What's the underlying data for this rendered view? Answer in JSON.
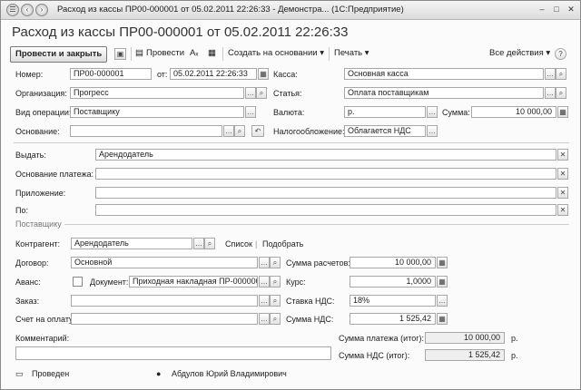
{
  "window": {
    "title": "Расход из кассы ПР00-000001 от 05.02.2011 22:26:33 - Демонстра... (1С:Предприятие)",
    "min_label": "–",
    "max_label": "□",
    "close_label": "✕"
  },
  "form": {
    "title": "Расход из кассы ПР00-000001 от 05.02.2011 22:26:33"
  },
  "toolbar": {
    "post_close": "Провести и закрыть",
    "post": "Провести",
    "create_based": "Создать на основании ▾",
    "print": "Печать ▾",
    "all_actions": "Все действия ▾",
    "help": "?"
  },
  "fields": {
    "number_label": "Номер:",
    "number": "ПР00-000001",
    "from_label": "от:",
    "date": "05.02.2011 22:26:33",
    "cashbox_label": "Касса:",
    "cashbox": "Основная касса",
    "org_label": "Организация:",
    "org": "Прогресс",
    "article_label": "Статья:",
    "article": "Оплата поставщикам",
    "optype_label": "Вид операции:",
    "optype": "Поставщику",
    "currency_label": "Валюта:",
    "currency": "р.",
    "sum_label": "Сумма:",
    "sum": "10 000,00",
    "basis_label": "Основание:",
    "basis": "",
    "tax_label": "Налогообложение:",
    "tax": "Облагается НДС",
    "issue_label": "Выдать:",
    "issue": "Арендодатель",
    "paybasis_label": "Основание платежа:",
    "paybasis": "",
    "attach_label": "Приложение:",
    "attach": "",
    "by_label": "По:",
    "by": ""
  },
  "supplier": {
    "group_label": "Поставщику",
    "counterparty_label": "Контрагент:",
    "counterparty": "Арендодатель",
    "list_link": "Список",
    "select_link": "Подобрать",
    "contract_label": "Договор:",
    "contract": "Основной",
    "calc_sum_label": "Сумма расчетов:",
    "calc_sum": "10 000,00",
    "advance_label": "Аванс:",
    "document_label": "Документ:",
    "document": "Приходная накладная ПР-000000",
    "rate_label": "Курс:",
    "rate": "1,0000",
    "order_label": "Заказ:",
    "order": "",
    "vat_rate_label": "Ставка НДС:",
    "vat_rate": "18%",
    "invoice_label": "Счет на оплату:",
    "invoice": "",
    "vat_sum_label": "Сумма НДС:",
    "vat_sum": "1 525,42"
  },
  "footer": {
    "comment_label": "Комментарий:",
    "comment": "",
    "total_pay_label": "Сумма платежа (итог):",
    "total_pay": "10 000,00",
    "total_pay_cur": "р.",
    "total_vat_label": "Сумма НДС (итог):",
    "total_vat": "1 525,42",
    "total_vat_cur": "р.",
    "status": "Проведен",
    "user": "Абдулов Юрий Владимирович"
  }
}
